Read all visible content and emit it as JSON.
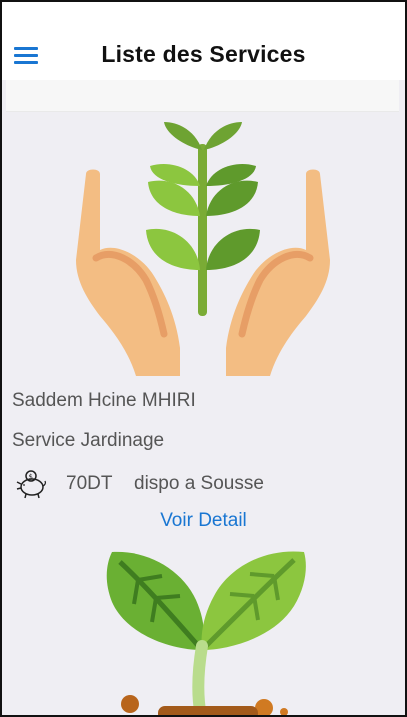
{
  "app_bar": {
    "title": "Liste des Services"
  },
  "services": [
    {
      "owner": "Saddem Hcine MHIRI",
      "name": "Service Jardinage",
      "price": "70DT",
      "availability": "dispo a Sousse",
      "detail_label": "Voir Detail",
      "image_icon": "hands-holding-plant-icon",
      "price_icon": "piggy-bank-icon"
    },
    {
      "image_icon": "sprout-icon"
    }
  ],
  "colors": {
    "accent": "#1976d2",
    "text_gray": "#555555",
    "background": "#efeef3",
    "leaf_dark": "#5f9a2c",
    "leaf_light": "#8cc63f",
    "hand": "#f3bd83"
  }
}
